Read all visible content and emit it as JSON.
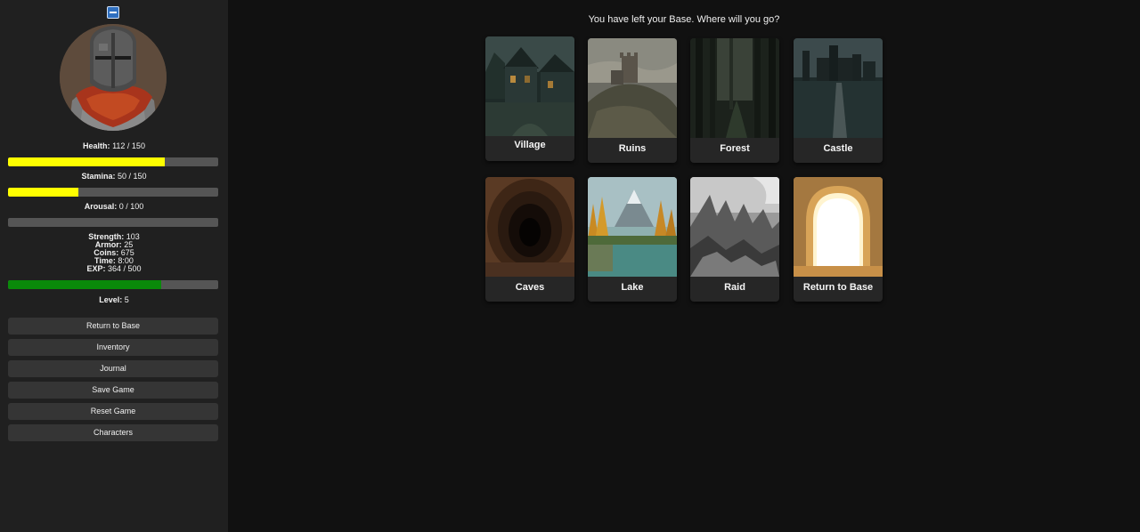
{
  "prompt": "You have left your Base. Where will you go?",
  "stats": {
    "health": {
      "label": "Health:",
      "value": "112 / 150",
      "current": 112,
      "max": 150,
      "color": "#ffff00"
    },
    "stamina": {
      "label": "Stamina:",
      "value": "50 / 150",
      "current": 50,
      "max": 150,
      "color": "#ffff00"
    },
    "arousal": {
      "label": "Arousal:",
      "value": "0 / 100",
      "current": 0,
      "max": 100,
      "color": "#ff66cc"
    },
    "strength": {
      "label": "Strength:",
      "value": "103"
    },
    "armor": {
      "label": "Armor:",
      "value": "25"
    },
    "coins": {
      "label": "Coins:",
      "value": "675"
    },
    "time": {
      "label": "Time:",
      "value": "8:00"
    },
    "exp": {
      "label": "EXP:",
      "value": "364 / 500",
      "current": 364,
      "max": 500,
      "color": "#0a8a0a"
    },
    "level": {
      "label": "Level:",
      "value": "5"
    }
  },
  "buttons": {
    "return_to_base": "Return to Base",
    "inventory": "Inventory",
    "journal": "Journal",
    "save_game": "Save Game",
    "reset_game": "Reset Game",
    "characters": "Characters"
  },
  "locations": [
    {
      "name": "Village"
    },
    {
      "name": "Ruins"
    },
    {
      "name": "Forest"
    },
    {
      "name": "Castle"
    },
    {
      "name": "Caves"
    },
    {
      "name": "Lake"
    },
    {
      "name": "Raid"
    },
    {
      "name": "Return to Base"
    }
  ]
}
